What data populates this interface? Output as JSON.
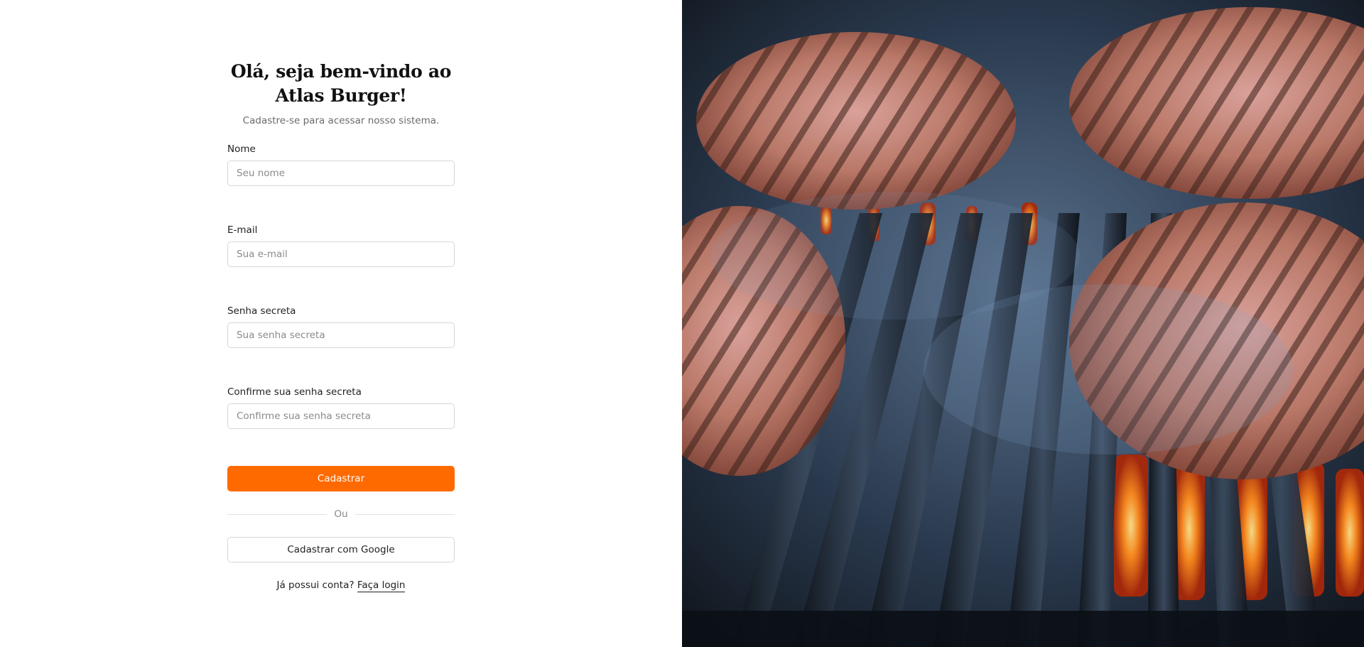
{
  "signup": {
    "title": "Olá, seja bem-vindo ao Atlas Burger!",
    "subtitle": "Cadastre-se para acessar nosso sistema.",
    "fields": [
      {
        "label": "Nome",
        "placeholder": "Seu nome"
      },
      {
        "label": "E-mail",
        "placeholder": "Sua e-mail"
      },
      {
        "label": "Senha secreta",
        "placeholder": "Sua senha secreta"
      },
      {
        "label": "Confirme sua senha secreta",
        "placeholder": "Confirme sua senha secreta"
      }
    ],
    "submit_label": "Cadastrar",
    "divider_label": "Ou",
    "google_label": "Cadastrar com Google",
    "login_prompt": "Já possui conta?",
    "login_link": "Faça login"
  },
  "colors": {
    "accent": "#ff6a00",
    "border": "#d7d7d7"
  },
  "hero_image": {
    "icon": "grill-burgers-photo"
  }
}
